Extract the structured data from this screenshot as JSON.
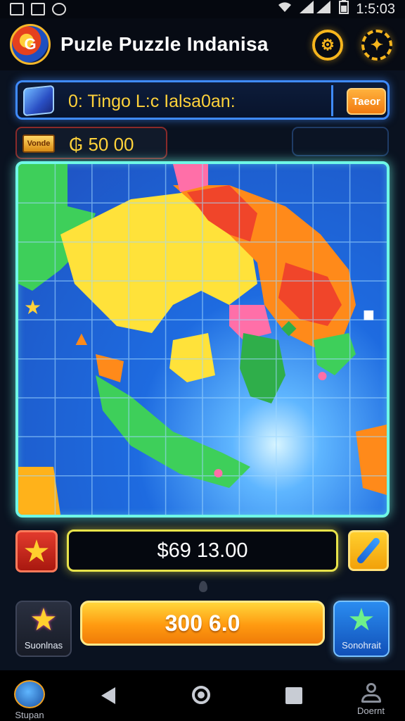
{
  "status_bar": {
    "time": "1:5:03",
    "left_icons": [
      "image-icon",
      "photo-icon",
      "notification-icon"
    ],
    "right_icons": [
      "wifi-icon",
      "signal-icon",
      "battery-icon"
    ]
  },
  "header": {
    "logo_letter": "G",
    "title": "Puzle Puzzle Indanisa",
    "buttons": [
      "settings-icon",
      "share-icon"
    ]
  },
  "mission": {
    "text": "0: Tingo L:c Ialsa0an:",
    "button_label": "Taeor"
  },
  "coins": {
    "ticket_label": "Vonde",
    "amount": "₲ 50 00"
  },
  "board": {
    "rows": 9,
    "cols": 10,
    "markers": [
      "star-icon",
      "character-icon",
      "character-icon",
      "character-icon",
      "character-icon",
      "cube-icon"
    ],
    "colors": {
      "ocean": "#1e5fd0",
      "land_green": "#3ecf5a",
      "land_yellow": "#ffe23a",
      "land_orange": "#ff8a1a",
      "land_red": "#f0452a",
      "land_pink": "#ff6fa8",
      "border": "#6ff7e6"
    }
  },
  "score": {
    "value": "$69 13.00"
  },
  "actions": {
    "left_label": "Suonlnas",
    "main_label": "300 6.0",
    "right_label": "Sonohrait"
  },
  "nav": {
    "left_label": "Stupan",
    "right_label": "Doernt"
  }
}
